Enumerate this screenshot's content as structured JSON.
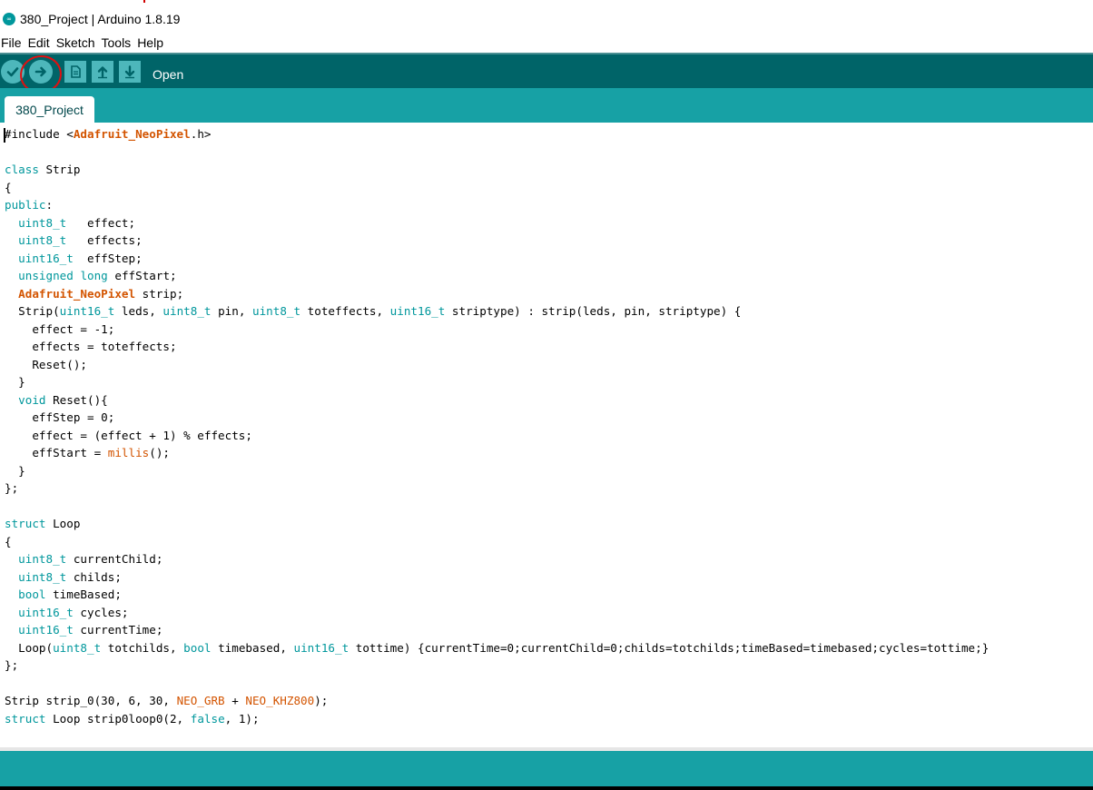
{
  "window": {
    "title": "380_Project | Arduino 1.8.19",
    "app_icon_glyph": "∞"
  },
  "menu": [
    "File",
    "Edit",
    "Sketch",
    "Tools",
    "Help"
  ],
  "toolbar": {
    "buttons": [
      {
        "name": "verify-button",
        "icon": "check-icon",
        "glyph": "✓"
      },
      {
        "name": "upload-button",
        "icon": "arrow-right-icon",
        "glyph": "➜"
      },
      {
        "name": "new-button",
        "icon": "new-file-icon",
        "glyph": "🗎"
      },
      {
        "name": "open-button",
        "icon": "arrow-up-icon",
        "glyph": "⬆"
      },
      {
        "name": "save-button",
        "icon": "arrow-down-icon",
        "glyph": "⬇"
      }
    ],
    "status_label": "Open"
  },
  "tabs": [
    {
      "label": "380_Project",
      "active": true
    }
  ],
  "colors": {
    "toolbar": "#006468",
    "tabstrip": "#17a1a5",
    "button": "#4db7bb",
    "keyword": "#00979c",
    "library": "#d35400"
  },
  "code_lines": [
    "#include <Adafruit_NeoPixel.h>",
    "",
    "class Strip",
    "{",
    "public:",
    "  uint8_t   effect;",
    "  uint8_t   effects;",
    "  uint16_t  effStep;",
    "  unsigned long effStart;",
    "  Adafruit_NeoPixel strip;",
    "  Strip(uint16_t leds, uint8_t pin, uint8_t toteffects, uint16_t striptype) : strip(leds, pin, striptype) {",
    "    effect = -1;",
    "    effects = toteffects;",
    "    Reset();",
    "  }",
    "  void Reset(){",
    "    effStep = 0;",
    "    effect = (effect + 1) % effects;",
    "    effStart = millis();",
    "  }",
    "};",
    "",
    "struct Loop",
    "{",
    "  uint8_t currentChild;",
    "  uint8_t childs;",
    "  bool timeBased;",
    "  uint16_t cycles;",
    "  uint16_t currentTime;",
    "  Loop(uint8_t totchilds, bool timebased, uint16_t tottime) {currentTime=0;currentChild=0;childs=totchilds;timeBased=timebased;cycles=tottime;}",
    "};",
    "",
    "Strip strip_0(30, 6, 30, NEO_GRB + NEO_KHZ800);",
    "struct Loop strip0loop0(2, false, 1);"
  ]
}
